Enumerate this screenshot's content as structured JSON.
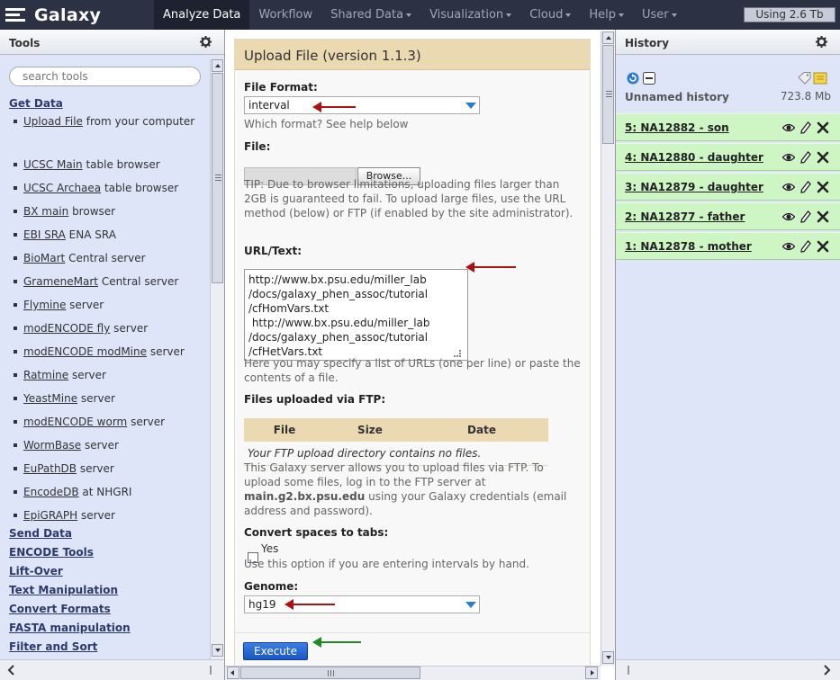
{
  "masthead": {
    "brand": "Galaxy",
    "tabs": [
      {
        "label": "Analyze Data",
        "active": true,
        "dropdown": false
      },
      {
        "label": "Workflow",
        "active": false,
        "dropdown": false
      },
      {
        "label": "Shared Data",
        "active": false,
        "dropdown": true
      },
      {
        "label": "Visualization",
        "active": false,
        "dropdown": true
      },
      {
        "label": "Cloud",
        "active": false,
        "dropdown": true
      },
      {
        "label": "Help",
        "active": false,
        "dropdown": true
      },
      {
        "label": "User",
        "active": false,
        "dropdown": true
      }
    ],
    "quota": "Using 2.6 Tb"
  },
  "tools": {
    "title": "Tools",
    "search_placeholder": "search tools",
    "get_data_title": "Get Data",
    "get_data_items": [
      {
        "link": "Upload File",
        "rest": " from your computer"
      },
      {
        "link": "UCSC Main",
        "rest": " table browser"
      },
      {
        "link": "UCSC Archaea",
        "rest": " table browser"
      },
      {
        "link": "BX main",
        "rest": " browser"
      },
      {
        "link": "EBI SRA",
        "rest": " ENA SRA"
      },
      {
        "link": "BioMart",
        "rest": " Central server"
      },
      {
        "link": "GrameneMart",
        "rest": " Central server"
      },
      {
        "link": "Flymine",
        "rest": " server"
      },
      {
        "link": "modENCODE fly",
        "rest": " server"
      },
      {
        "link": "modENCODE modMine",
        "rest": " server"
      },
      {
        "link": "Ratmine",
        "rest": " server"
      },
      {
        "link": "YeastMine",
        "rest": " server"
      },
      {
        "link": "modENCODE worm",
        "rest": " server"
      },
      {
        "link": "WormBase",
        "rest": " server"
      },
      {
        "link": "EuPathDB",
        "rest": " server"
      },
      {
        "link": "EncodeDB",
        "rest": " at NHGRI"
      },
      {
        "link": "EpiGRAPH",
        "rest": " server"
      }
    ],
    "sections": [
      "Send Data",
      "ENCODE Tools",
      "Lift-Over",
      "Text Manipulation",
      "Convert Formats",
      "FASTA manipulation",
      "Filter and Sort"
    ]
  },
  "upload": {
    "title": "Upload File (version 1.1.3)",
    "file_format_label": "File Format:",
    "file_format_value": "interval",
    "file_format_help": "Which format? See help below",
    "file_label": "File:",
    "browse_label": "Browse...",
    "file_tip": "TIP: Due to browser limitations, uploading files larger than 2GB is guaranteed to fail. To upload large files, use the URL method (below) or FTP (if enabled by the site administrator).",
    "url_label": "URL/Text:",
    "url_value": "http://www.bx.psu.edu/miller_lab\n/docs/galaxy_phen_assoc/tutorial\n/cfHomVars.txt\n http://www.bx.psu.edu/miller_lab\n/docs/galaxy_phen_assoc/tutorial\n/cfHetVars.txt",
    "url_help": "Here you may specify a list of URLs (one per line) or paste the contents of a file.",
    "ftp_label": "Files uploaded via FTP:",
    "ftp_columns": [
      "File",
      "Size",
      "Date"
    ],
    "ftp_empty": "Your FTP upload directory contains no files.",
    "ftp_help_pre": "This Galaxy server allows you to upload files via FTP. To upload some files, log in to the FTP server at ",
    "ftp_server": "main.g2.bx.psu.edu",
    "ftp_help_post": " using your Galaxy credentials (email address and password).",
    "spaces_label": "Convert spaces to tabs:",
    "spaces_option": "Yes",
    "spaces_help": "Use this option if you are entering intervals by hand.",
    "genome_label": "Genome:",
    "genome_value": "hg19",
    "execute_label": "Execute"
  },
  "history": {
    "title": "History",
    "name": "Unnamed history",
    "size": "723.8 Mb",
    "datasets": [
      "5: NA12882 - son",
      "4: NA12880 - daughter",
      "3: NA12879 - daughter",
      "2: NA12877 - father",
      "1: NA12878 - mother"
    ]
  },
  "colors": {
    "masthead": "#2c3143",
    "panel": "#dfe5f9",
    "form_header": "#ebd9b2",
    "dataset_ok": "#cef6c5",
    "annotation_red": "#b01010",
    "annotation_green": "#1f8a1f"
  }
}
